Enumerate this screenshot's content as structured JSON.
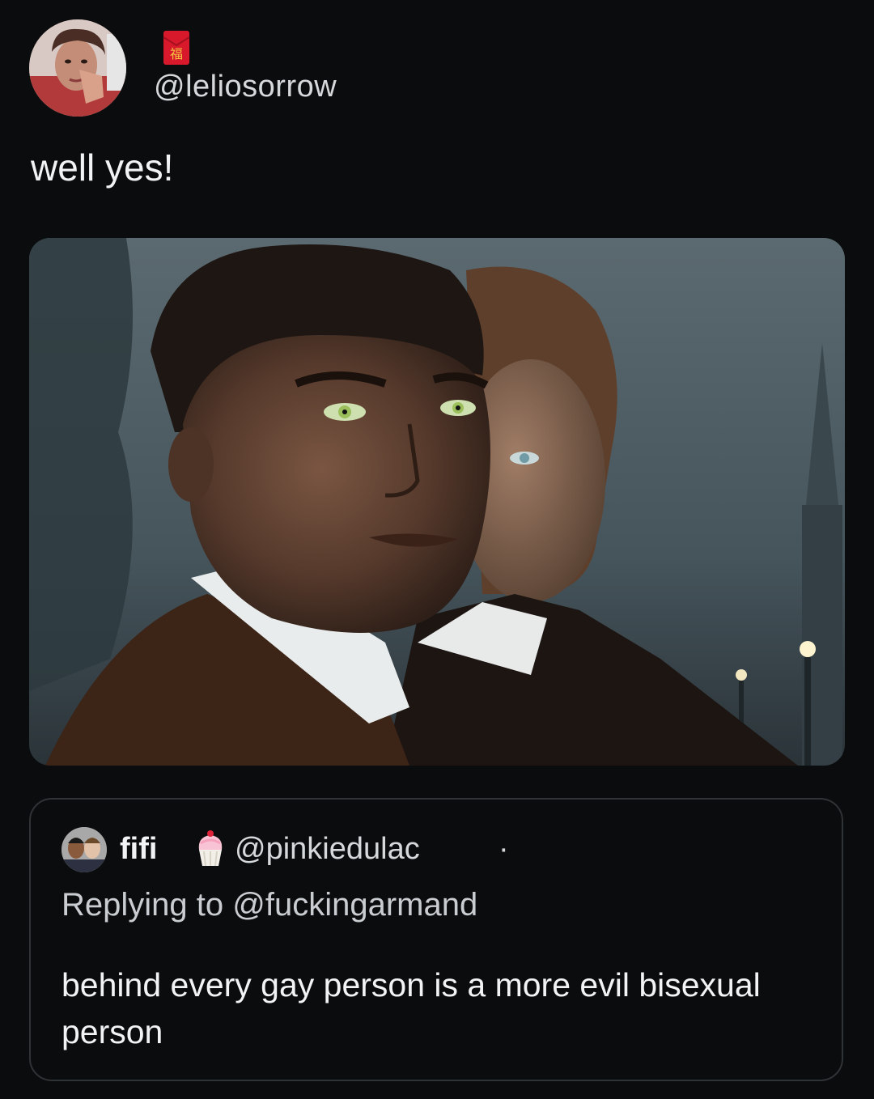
{
  "tweet": {
    "handle": "@leliosorrow",
    "text": "well yes!",
    "badge_icon": "red-envelope-fu-icon",
    "badge_char": "福"
  },
  "media": {
    "icon": "image-vampire-portrait"
  },
  "quote": {
    "name": "fifi",
    "name_badge_icon": "cupcake-icon",
    "handle": "@pinkiedulac",
    "separator": "·",
    "replying_prefix": "Replying to",
    "replying_handle": "@fuckingarmand",
    "text": "behind every gay person is a more evil bisexual person"
  },
  "colors": {
    "background": "#0b0c0d",
    "text": "#e7e9ea",
    "border": "#2f3336"
  }
}
